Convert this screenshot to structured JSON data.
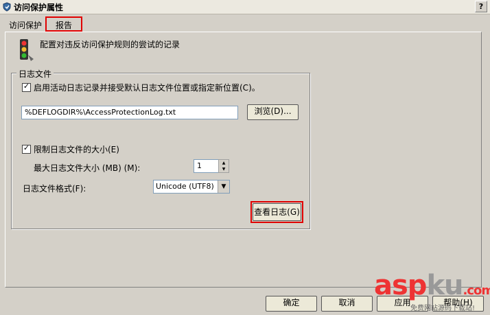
{
  "window": {
    "title": "访问保护属性",
    "help_label": "?"
  },
  "tabs": [
    {
      "label": "访问保护"
    },
    {
      "label": "报告"
    }
  ],
  "header": {
    "description": "配置对违反访问保护规则的尝试的记录"
  },
  "log_group": {
    "label": "日志文件",
    "enable_logging_label": "启用活动日志记录并接受默认日志文件位置或指定新位置(C)。",
    "enable_logging_checked": true,
    "path_value": "%DEFLOGDIR%\\AccessProtectionLog.txt",
    "browse_label": "浏览(D)...",
    "limit_size_label": "限制日志文件的大小(E)",
    "limit_size_checked": true,
    "max_size_label": "最大日志文件大小 (MB) (M):",
    "max_size_value": "1",
    "format_label": "日志文件格式(F):",
    "format_value": "Unicode (UTF8)",
    "view_log_label": "查看日志(G)"
  },
  "footer": {
    "ok_label": "确定",
    "cancel_label": "取消",
    "apply_label": "应用",
    "help_label": "帮助(H)"
  },
  "watermark": {
    "brand_a": "asp",
    "brand_b": "ku",
    "brand_c": ".com",
    "subtitle": "免费网站源码下载站!"
  },
  "colors": {
    "highlight_box": "#e00000",
    "background": "#d4d0c8"
  }
}
